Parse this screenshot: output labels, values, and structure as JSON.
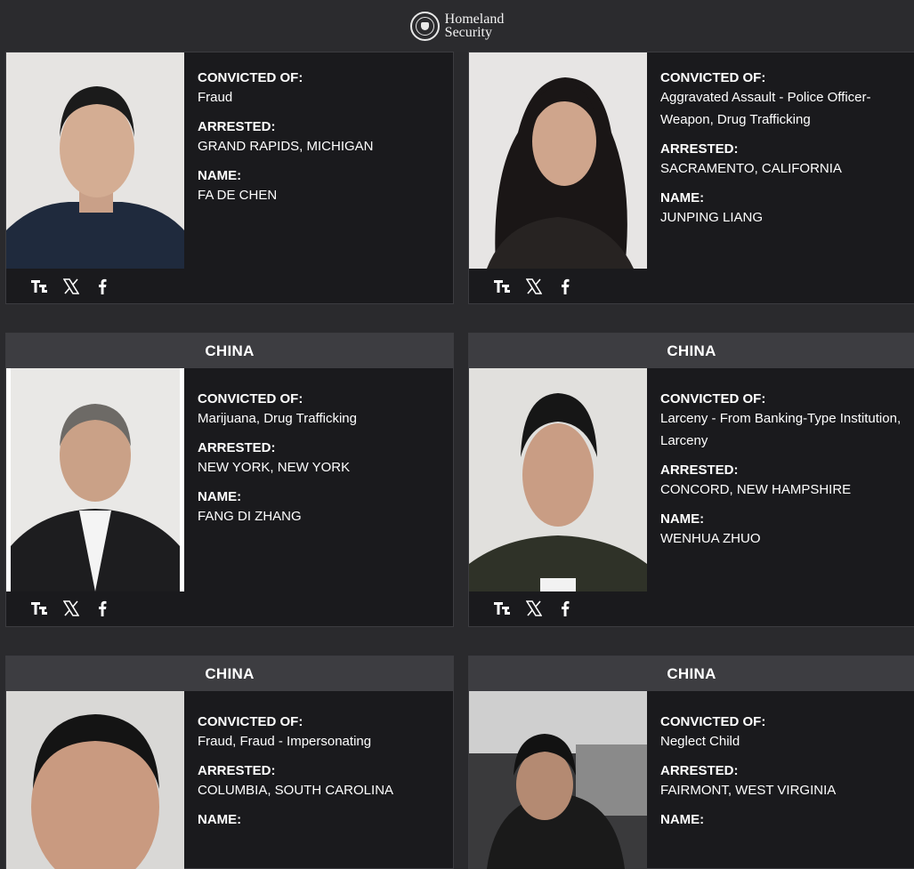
{
  "header": {
    "logo_line1": "Homeland",
    "logo_line2": "Security"
  },
  "labels": {
    "convicted": "CONVICTED OF:",
    "arrested": "ARRESTED:",
    "name": "NAME:"
  },
  "cards": [
    {
      "country": "",
      "convicted": "Fraud",
      "arrested": "GRAND RAPIDS, MICHIGAN",
      "name": "FA DE CHEN"
    },
    {
      "country": "",
      "convicted": "Aggravated Assault - Police Officer-Weapon, Drug Trafficking",
      "arrested": "SACRAMENTO, CALIFORNIA",
      "name": "JUNPING LIANG"
    },
    {
      "country": "CHINA",
      "convicted": "Marijuana, Drug Trafficking",
      "arrested": "NEW YORK, NEW YORK",
      "name": "FANG DI ZHANG"
    },
    {
      "country": "CHINA",
      "convicted": "Larceny - From Banking-Type Institution, Larceny",
      "arrested": "CONCORD, NEW HAMPSHIRE",
      "name": "WENHUA ZHUO"
    },
    {
      "country": "CHINA",
      "convicted": "Fraud, Fraud - Impersonating",
      "arrested": "COLUMBIA, SOUTH CAROLINA",
      "name": ""
    },
    {
      "country": "CHINA",
      "convicted": "Neglect Child",
      "arrested": "FAIRMONT, WEST VIRGINIA",
      "name": ""
    }
  ],
  "social_icons": [
    "truth-social-icon",
    "x-icon",
    "facebook-icon"
  ]
}
